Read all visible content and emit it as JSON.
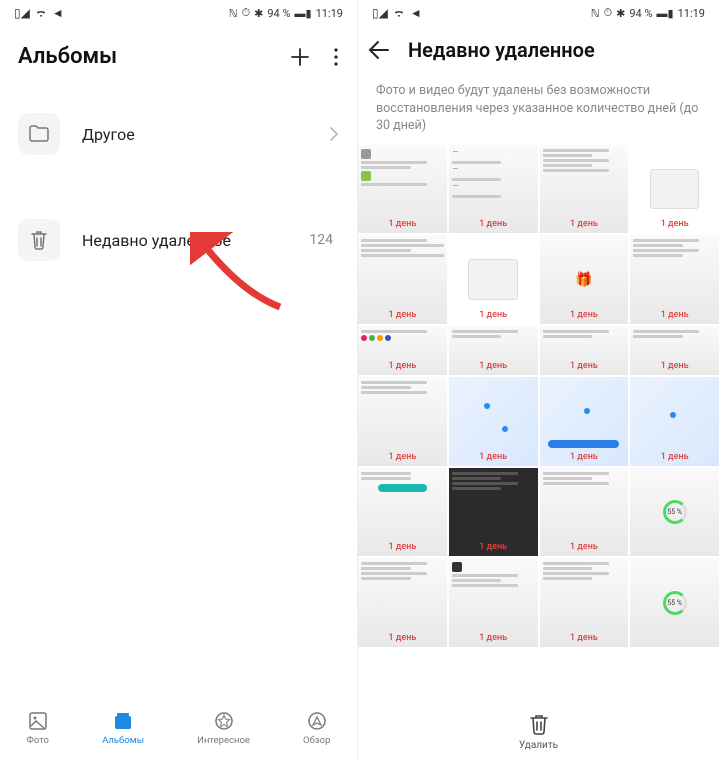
{
  "status": {
    "time": "11:19",
    "battery": "94 %",
    "signal_icons": "▮◢ ⧉ ◄",
    "right_icons": "ℕ ⏱ ✱"
  },
  "left": {
    "title": "Альбомы",
    "items": {
      "other": {
        "label": "Другое"
      },
      "recently_deleted": {
        "label": "Недавно удаленное",
        "count": "124"
      }
    },
    "nav": {
      "photo": "Фото",
      "albums": "Альбомы",
      "interesting": "Интересное",
      "overview": "Обзор"
    }
  },
  "right": {
    "title": "Недавно удаленное",
    "info": "Фото и видео будут удалены без возможности восстановления через указанное количество дней (до 30 дней)",
    "day_label": "1 день",
    "percent": "55 %",
    "delete_label": "Удалить"
  }
}
